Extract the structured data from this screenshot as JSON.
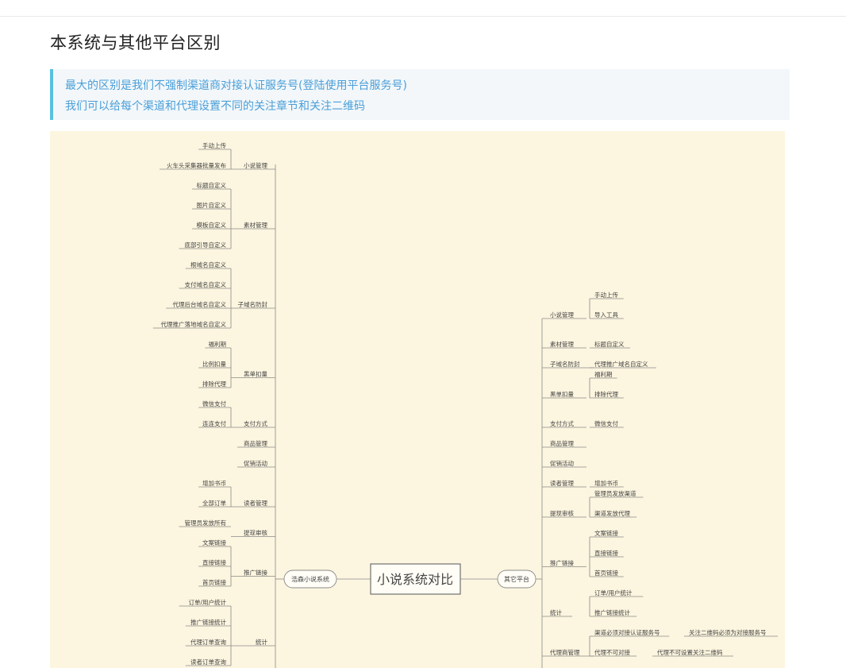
{
  "page": {
    "title": "本系统与其他平台区别",
    "notes": [
      "最大的区别是我们不强制渠道商对接认证服务号(登陆使用平台服务号)",
      "我们可以给每个渠道和代理设置不同的关注章节和关注二维码"
    ]
  },
  "mindmap": {
    "root": "小说系统对比",
    "left_branch": "浩森小说系统",
    "right_branch": "其它平台",
    "left_groups": [
      {
        "label": "小说管理",
        "items": [
          "手动上传",
          "火车头采集器批量发布"
        ]
      },
      {
        "label": "素材管理",
        "items": [
          "标题自定义",
          "图片自定义",
          "模板自定义",
          "底部引导自定义"
        ]
      },
      {
        "label": "子域名防封",
        "items": [
          "根域名自定义",
          "支付域名自定义",
          "代理后台域名自定义",
          "代理推广落地域名自定义"
        ]
      },
      {
        "label": "黑单扣量",
        "items": [
          "福利期",
          "比例扣量",
          "排除代理"
        ]
      },
      {
        "label": "支付方式",
        "items": [
          "微信支付",
          "连连支付"
        ]
      },
      {
        "label": "商品管理",
        "items": []
      },
      {
        "label": "促销活动",
        "items": []
      },
      {
        "label": "读者管理",
        "items": [
          "增加书币",
          "全部订单"
        ]
      },
      {
        "label": "提现审核",
        "items": [
          "管理员发放所有"
        ]
      },
      {
        "label": "推广链接",
        "items": [
          "文案链接",
          "直接链接",
          "首页链接"
        ]
      },
      {
        "label": "统计",
        "items": [
          "订单/用户统计",
          "推广链接统计",
          "代理订单查询",
          "读者订单查询"
        ]
      }
    ],
    "right_groups": [
      {
        "label": "小说管理",
        "items": [
          "手动上传",
          "导入工具"
        ]
      },
      {
        "label": "素材管理",
        "items": [
          "标题自定义"
        ]
      },
      {
        "label": "子域名防封",
        "items": [
          "代理推广域名自定义"
        ]
      },
      {
        "label": "黑单扣量",
        "items": [
          "福利期",
          "排除代理"
        ]
      },
      {
        "label": "支付方式",
        "items": [
          "微信支付"
        ]
      },
      {
        "label": "商品管理",
        "items": []
      },
      {
        "label": "促销活动",
        "items": []
      },
      {
        "label": "读者管理",
        "items": [
          "增加书币"
        ]
      },
      {
        "label": "提现审核",
        "items": [
          "管理员发放渠道",
          "渠道发放代理"
        ]
      },
      {
        "label": "推广链接",
        "items": [
          "文案链接",
          "直接链接",
          "首页链接"
        ]
      },
      {
        "label": "统计",
        "items": [
          "订单/用户统计",
          "推广链接统计"
        ]
      },
      {
        "label": "代理商管理",
        "items": [
          "渠道必须对接认证服务号",
          "代理不可对接"
        ]
      }
    ],
    "right_extra": [
      "关注二维码必须为对接服务号",
      "代理不可设置关注二维码"
    ]
  }
}
